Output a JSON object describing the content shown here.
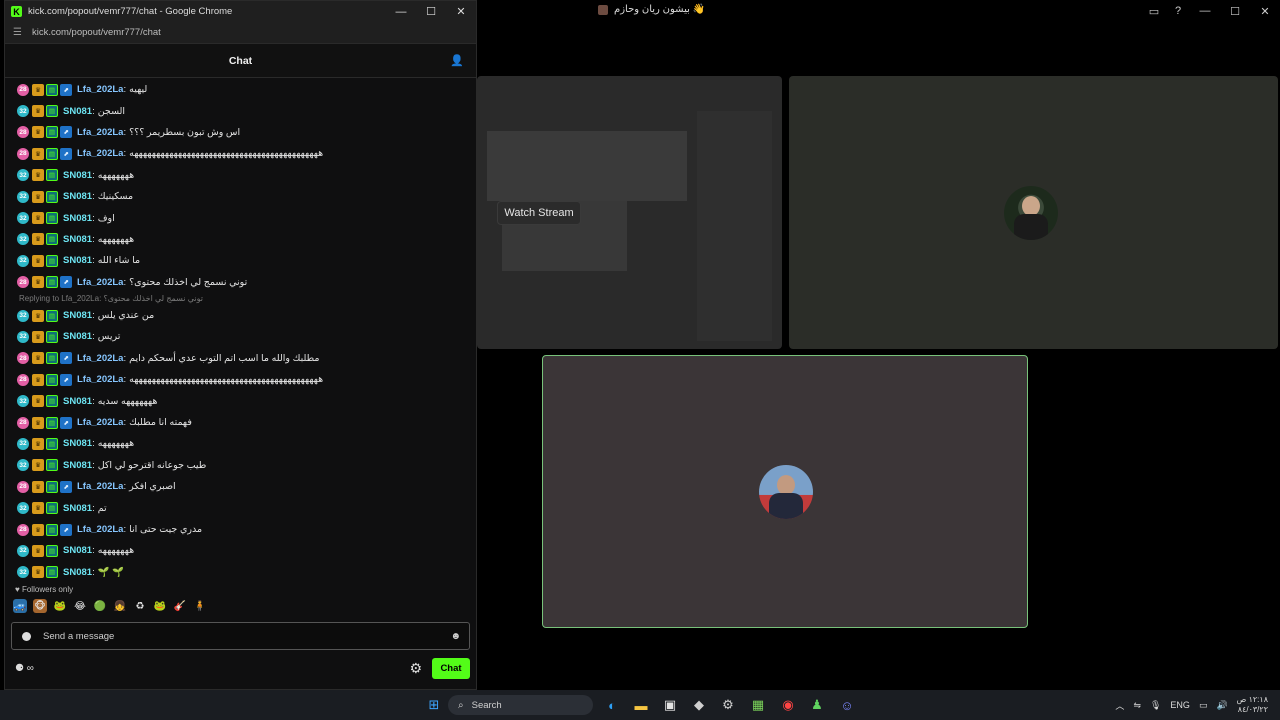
{
  "background_window": {
    "title": "بيشون ريان وحازم 👋",
    "watch_stream_label": "Watch Stream"
  },
  "chrome": {
    "window_title": "kick.com/popout/vemr777/chat - Google Chrome",
    "url": "kick.com/popout/vemr777/chat",
    "minimize": "—",
    "maximize": "☐",
    "close": "✕"
  },
  "chat": {
    "header_title": "Chat",
    "messages": [
      {
        "sub": "28",
        "user": "Lfa_202La",
        "text": "ليهيه"
      },
      {
        "sub": "32",
        "user": "SN081",
        "text": "السجن"
      },
      {
        "sub": "28",
        "user": "Lfa_202La",
        "text": "اس وش تبون بسطريمر ؟؟؟"
      },
      {
        "sub": "28",
        "user": "Lfa_202La",
        "text": "هههههههههههههههههههههههههههههههههههههههههههه"
      },
      {
        "sub": "32",
        "user": "SN081",
        "text": "هههههههه"
      },
      {
        "sub": "32",
        "user": "SN081",
        "text": "مسكينيك"
      },
      {
        "sub": "32",
        "user": "SN081",
        "text": "اوف"
      },
      {
        "sub": "32",
        "user": "SN081",
        "text": "هههههههه"
      },
      {
        "sub": "32",
        "user": "SN081",
        "text": "ما شاء الله"
      },
      {
        "sub": "28",
        "user": "Lfa_202La",
        "text": "توني نسمج لي اخذلك محتوى؟"
      },
      {
        "sub": "32",
        "user": "SN081",
        "text": "من عندي يلس",
        "reply": "Replying to Lfa_202La: توني نسمج لي اخذلك محتوى؟"
      },
      {
        "sub": "32",
        "user": "SN081",
        "text": "تريس"
      },
      {
        "sub": "28",
        "user": "Lfa_202La",
        "text": "مطلبك والله ما اسب اتم التوب عدي أسحكم دايم"
      },
      {
        "sub": "28",
        "user": "Lfa_202La",
        "text": "هههههههههههههههههههههههههههههههههههههههههههه"
      },
      {
        "sub": "32",
        "user": "SN081",
        "text": "هههههههه سديه"
      },
      {
        "sub": "28",
        "user": "Lfa_202La",
        "text": "فهمته انا مطلبك"
      },
      {
        "sub": "32",
        "user": "SN081",
        "text": "هههههههه"
      },
      {
        "sub": "32",
        "user": "SN081",
        "text": "طيب جوعانه اقترحو لي اكل"
      },
      {
        "sub": "28",
        "user": "Lfa_202La",
        "text": "اصبري افكر"
      },
      {
        "sub": "32",
        "user": "SN081",
        "text": "تم"
      },
      {
        "sub": "28",
        "user": "Lfa_202La",
        "text": "مدري جيت حتى انا"
      },
      {
        "sub": "32",
        "user": "SN081",
        "text": "هههههههه"
      },
      {
        "sub": "32",
        "user": "SN081",
        "text": "🌱 🌱"
      }
    ],
    "followers_only": "♥ Followers only",
    "input_placeholder": "Send a message",
    "points": "∞",
    "send_label": "Chat"
  },
  "taskbar": {
    "search_label": "Search",
    "language": "ENG",
    "time": "١٢:١٨ ص",
    "date": "٨٤/٠٣/٢٢"
  }
}
